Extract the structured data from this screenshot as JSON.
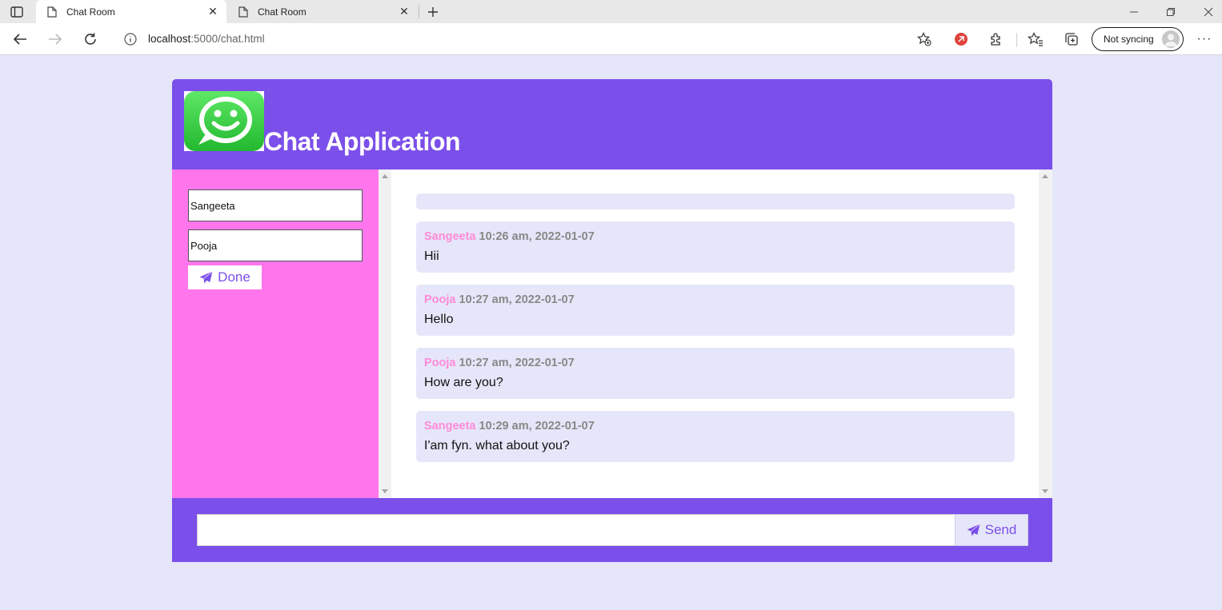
{
  "browser": {
    "tabs": [
      {
        "title": "Chat Room",
        "active": true
      },
      {
        "title": "Chat Room",
        "active": false
      }
    ],
    "url_host": "localhost",
    "url_path": ":5000/chat.html",
    "profile_label": "Not syncing"
  },
  "app": {
    "title": "Chat Application",
    "colors": {
      "header": "#7b4fe9",
      "sidebar": "#ff76ec",
      "page": "#e6e6fa",
      "sender": "#ff8ad8"
    },
    "sidebar": {
      "name_value": "Sangeeta",
      "room_value": "Pooja",
      "done_label": "Done"
    },
    "messages": [
      {
        "sender": "Sangeeta",
        "time": "10:26 am, 2022-01-07",
        "text": "Hii"
      },
      {
        "sender": "Pooja",
        "time": "10:27 am, 2022-01-07",
        "text": "Hello"
      },
      {
        "sender": "Pooja",
        "time": "10:27 am, 2022-01-07",
        "text": "How are you?"
      },
      {
        "sender": "Sangeeta",
        "time": "10:29 am, 2022-01-07",
        "text": "I'am fyn. what about you?"
      }
    ],
    "footer": {
      "input_value": "",
      "send_label": "Send"
    }
  }
}
